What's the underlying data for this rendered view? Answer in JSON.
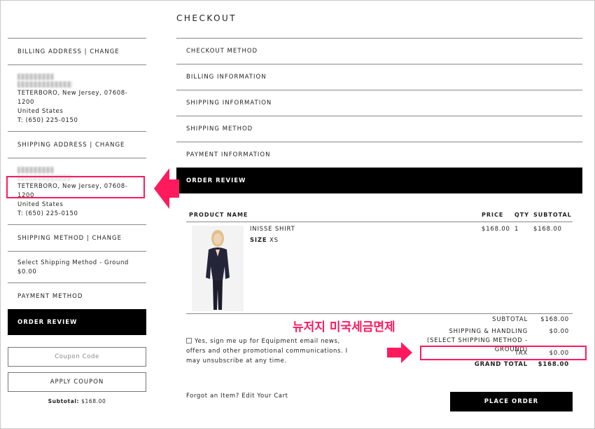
{
  "page": {
    "title": "CHECKOUT"
  },
  "sidebar": {
    "billing": {
      "header": "BILLING ADDRESS | CHANGE",
      "city": "TETERBORO, New Jersey, 07608-1200",
      "country": "United States",
      "phone": "T: (650) 225-0150"
    },
    "shipping": {
      "header": "SHIPPING ADDRESS | CHANGE",
      "city": "TETERBORO, New Jersey, 07608-1200",
      "country": "United States",
      "phone": "T: (650) 225-0150"
    },
    "method": {
      "header": "SHIPPING METHOD | CHANGE",
      "value": "Select Shipping Method - Ground",
      "price": "$0.00"
    },
    "payment": {
      "header": "PAYMENT METHOD"
    },
    "review": {
      "header": "ORDER REVIEW"
    },
    "coupon": {
      "placeholder": "Coupon Code",
      "apply_label": "APPLY COUPON",
      "subtotal_label": "Subtotal:",
      "subtotal_value": "$168.00"
    }
  },
  "steps": [
    {
      "label": "CHECKOUT METHOD"
    },
    {
      "label": "BILLING INFORMATION"
    },
    {
      "label": "SHIPPING INFORMATION"
    },
    {
      "label": "SHIPPING METHOD"
    },
    {
      "label": "PAYMENT INFORMATION"
    },
    {
      "label": "ORDER REVIEW"
    }
  ],
  "table": {
    "headers": {
      "product": "PRODUCT NAME",
      "price": "PRICE",
      "qty": "QTY",
      "subtotal": "SUBTOTAL"
    },
    "items": [
      {
        "name": "INISSE SHIRT",
        "size_label": "SIZE",
        "size_value": "XS",
        "price": "$168.00",
        "qty": "1",
        "subtotal": "$168.00"
      }
    ]
  },
  "totals": {
    "subtotal_label": "SUBTOTAL",
    "subtotal_value": "$168.00",
    "shipping_label": "SHIPPING & HANDLING (SELECT SHIPPING METHOD - GROUND)",
    "shipping_value": "$0.00",
    "tax_label": "TAX",
    "tax_value": "$0.00",
    "grand_label": "GRAND TOTAL",
    "grand_value": "$168.00"
  },
  "newsletter": {
    "text": "Yes, sign me up for Equipment email news, offers and other promotional communications. I may unsubscribe at any time."
  },
  "footer": {
    "forgot_text": "Forgot an Item? Edit Your Cart",
    "place_order_label": "PLACE ORDER"
  },
  "annotation": {
    "korean_text": "뉴저지 미국세금면제",
    "color": "#ff1a5e"
  }
}
